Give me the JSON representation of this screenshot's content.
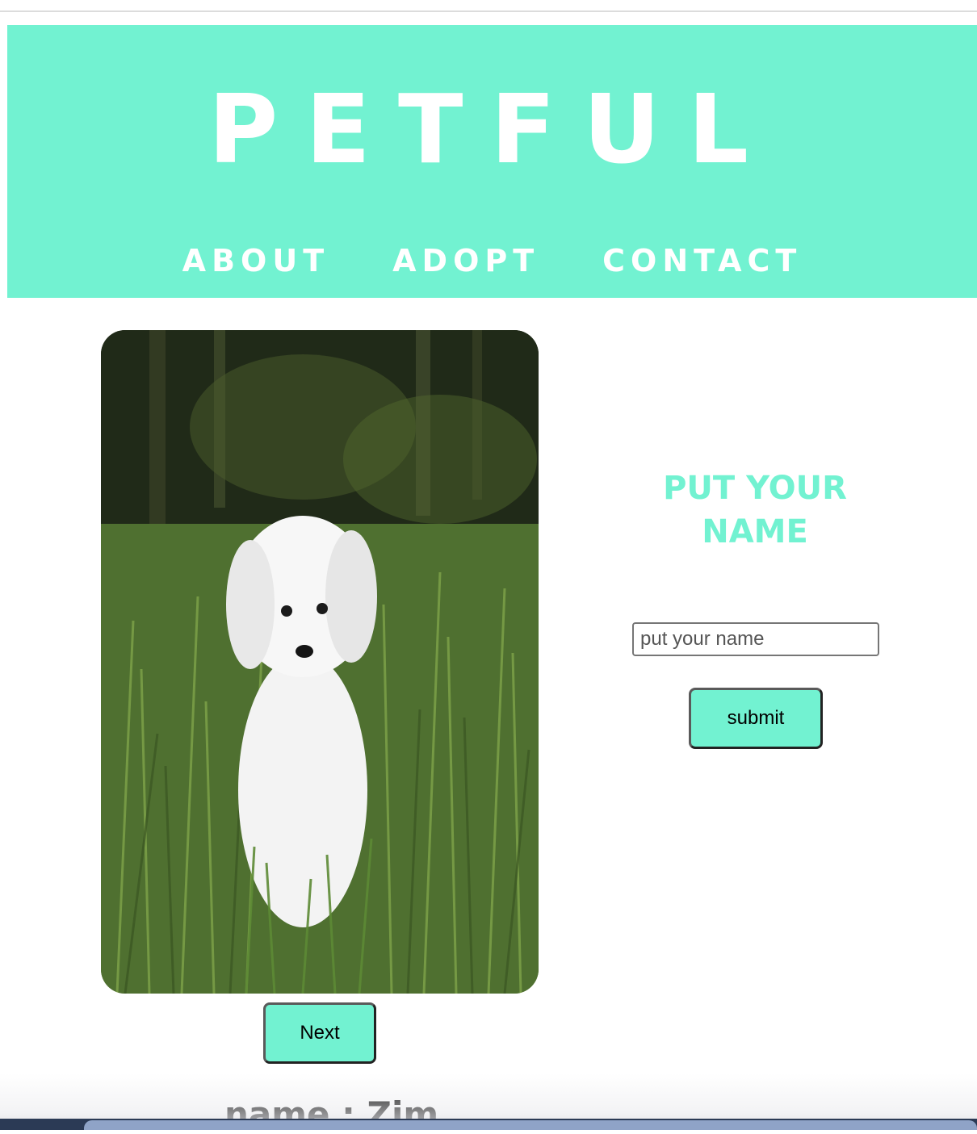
{
  "site": {
    "logo": "PETFUL",
    "brand_color": "#72f2d1"
  },
  "nav": {
    "items": [
      {
        "label": "ABOUT"
      },
      {
        "label": "ADOPT"
      },
      {
        "label": "CONTACT"
      }
    ]
  },
  "pet": {
    "photo_icon": "dog-photo",
    "next_label": "Next",
    "name_text": "name : Zim"
  },
  "form": {
    "title": "Put your name",
    "input_placeholder": "put your name",
    "input_value": "",
    "submit_label": "submit"
  }
}
